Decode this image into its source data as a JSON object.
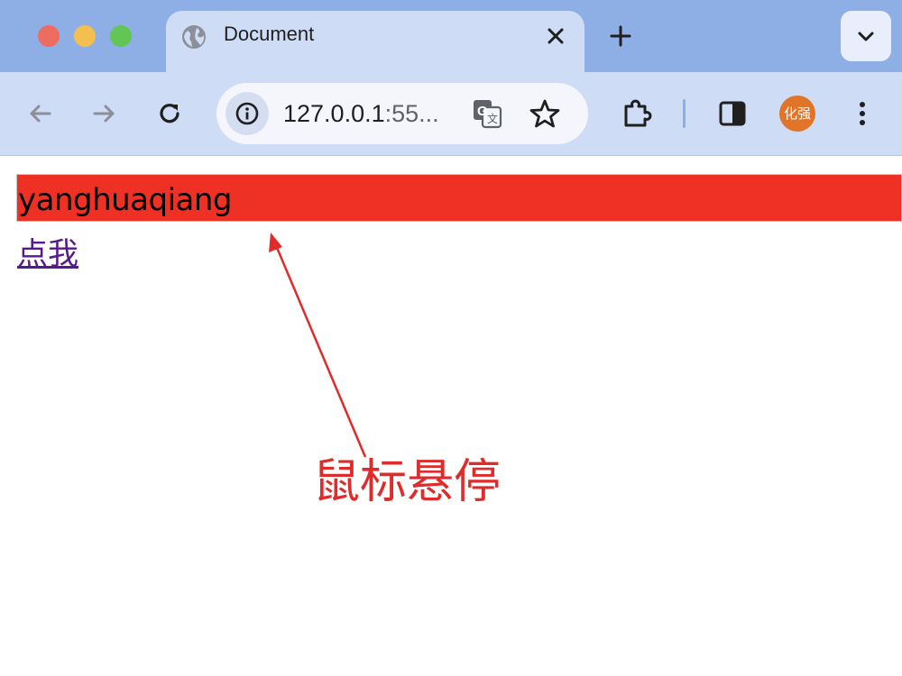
{
  "window": {
    "traffic_lights": [
      "close",
      "minimize",
      "zoom"
    ]
  },
  "tab": {
    "title": "Document",
    "favicon": "globe-icon"
  },
  "toolbar": {
    "url_host": "127.0.0.1",
    "url_port": ":55...",
    "avatar_text": "化强"
  },
  "page": {
    "hover_text": "yanghuaqiang",
    "link_text": "点我",
    "annotation_text": "鼠标悬停"
  },
  "colors": {
    "tabstrip": "#8eaee6",
    "toolbar": "#cfdcf5",
    "hover_box": "#ee3124",
    "link": "#551a8b",
    "annotation": "#e02b2b",
    "avatar": "#e07428"
  }
}
